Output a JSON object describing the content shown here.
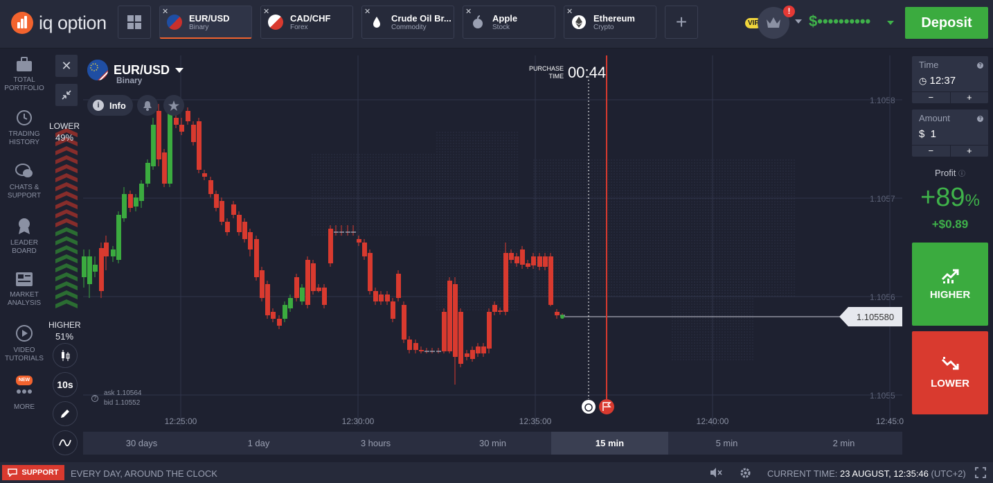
{
  "brand": {
    "name": "iq option"
  },
  "tabs": [
    {
      "name": "EUR/USD",
      "type": "Binary",
      "active": true
    },
    {
      "name": "CAD/CHF",
      "type": "Forex"
    },
    {
      "name": "Crude Oil Br...",
      "type": "Commodity"
    },
    {
      "name": "Apple",
      "type": "Stock"
    },
    {
      "name": "Ethereum",
      "type": "Crypto"
    }
  ],
  "header": {
    "vip": "VIP",
    "alert": "!",
    "balance": "$••••••••••",
    "deposit": "Deposit"
  },
  "sidebar": [
    {
      "label": "TOTAL PORTFOLIO",
      "icon": "briefcase-icon"
    },
    {
      "label": "TRADING HISTORY",
      "icon": "history-icon"
    },
    {
      "label": "CHATS & SUPPORT",
      "icon": "chat-icon"
    },
    {
      "label": "LEADER BOARD",
      "icon": "medal-icon"
    },
    {
      "label": "MARKET ANALYSIS",
      "icon": "newspaper-icon"
    },
    {
      "label": "VIDEO TUTORIALS",
      "icon": "play-icon"
    },
    {
      "label": "MORE",
      "badge": "NEW",
      "icon": "dots-icon"
    }
  ],
  "asset": {
    "name": "EUR/USD",
    "type": "Binary",
    "info": "Info"
  },
  "sentiment": {
    "lower_label": "LOWER",
    "lower_pct": "49%",
    "higher_label": "HIGHER",
    "higher_pct": "51%"
  },
  "chart_tools": {
    "interval": "10s"
  },
  "purchase": {
    "label": "PURCHASE TIME",
    "time": "00:44"
  },
  "quote": {
    "ask": "ask 1.10564",
    "bid": "bid 1.10552",
    "current": "1.105580"
  },
  "chart_data": {
    "type": "candlestick",
    "y_ticks": [
      "1.1058",
      "1.1057",
      "1.1056",
      "1.1055"
    ],
    "x_ticks": [
      "12:25:00",
      "12:30:00",
      "12:35:00",
      "12:40:00",
      "12:45:0"
    ],
    "current_price": 1.10558
  },
  "timeframes": [
    "30 days",
    "1 day",
    "3 hours",
    "30 min",
    "15 min",
    "5 min",
    "2 min"
  ],
  "active_timeframe": "15 min",
  "trade": {
    "time_label": "Time",
    "time_value": "12:37",
    "amount_label": "Amount",
    "amount_value": "$  1",
    "minus": "−",
    "plus": "+",
    "profit_label": "Profit",
    "profit_pct": "+89",
    "profit_pct_sign": "%",
    "profit_amount": "+$0.89",
    "higher": "HIGHER",
    "lower": "LOWER",
    "higher_color": "#3bab3f",
    "lower_color": "#d93a2f"
  },
  "footer": {
    "support": "SUPPORT",
    "tagline": "EVERY DAY, AROUND THE CLOCK",
    "current_time_label": "CURRENT TIME:",
    "current_time": "23 AUGUST, 12:35:46",
    "timezone": "(UTC+2)"
  }
}
